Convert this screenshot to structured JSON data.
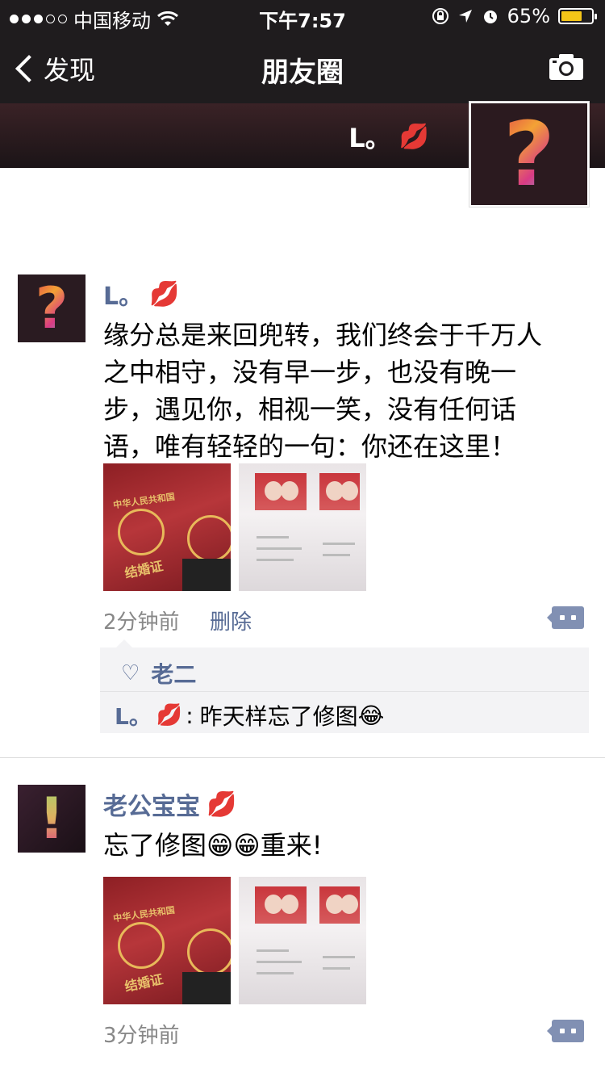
{
  "status": {
    "carrier": "中国移动",
    "time": "下午7:57",
    "battery": "65%",
    "battery_level": 0.65,
    "icons": [
      "signal-dots-icon",
      "wifi-icon",
      "orientation-lock-icon",
      "location-icon",
      "alarm-icon",
      "battery-icon"
    ]
  },
  "nav": {
    "back_label": "发现",
    "title": "朋友圈",
    "camera_icon": "camera-icon"
  },
  "cover": {
    "name": "L。",
    "lips": "💋"
  },
  "posts": [
    {
      "name": "L。",
      "lips": "💋",
      "content": "缘分总是来回兜转，我们终会于千万人之中相守，没有早一步，也没有晚一步，遇见你，相视一笑，没有任何话语，唯有轻轻的一句：你还在这里！",
      "time": "2分钟前",
      "delete_label": "删除",
      "likes": "老二",
      "comments": [
        {
          "name": "L。",
          "lips": "💋",
          "sep": ":",
          "text": "昨天样忘了修图",
          "emoji": "😂"
        }
      ]
    },
    {
      "name": "老公宝宝",
      "lips": "💋",
      "content_a": "忘了修图",
      "emoji_a": "😁",
      "emoji_b": "😁",
      "content_b": "重来!",
      "time": "3分钟前"
    }
  ],
  "cert_text": {
    "country": "中华人民共和国",
    "title": "结婚证"
  },
  "colors": {
    "bar": "#1f1c1e",
    "link": "#576b95",
    "battery": "#f5c518"
  }
}
